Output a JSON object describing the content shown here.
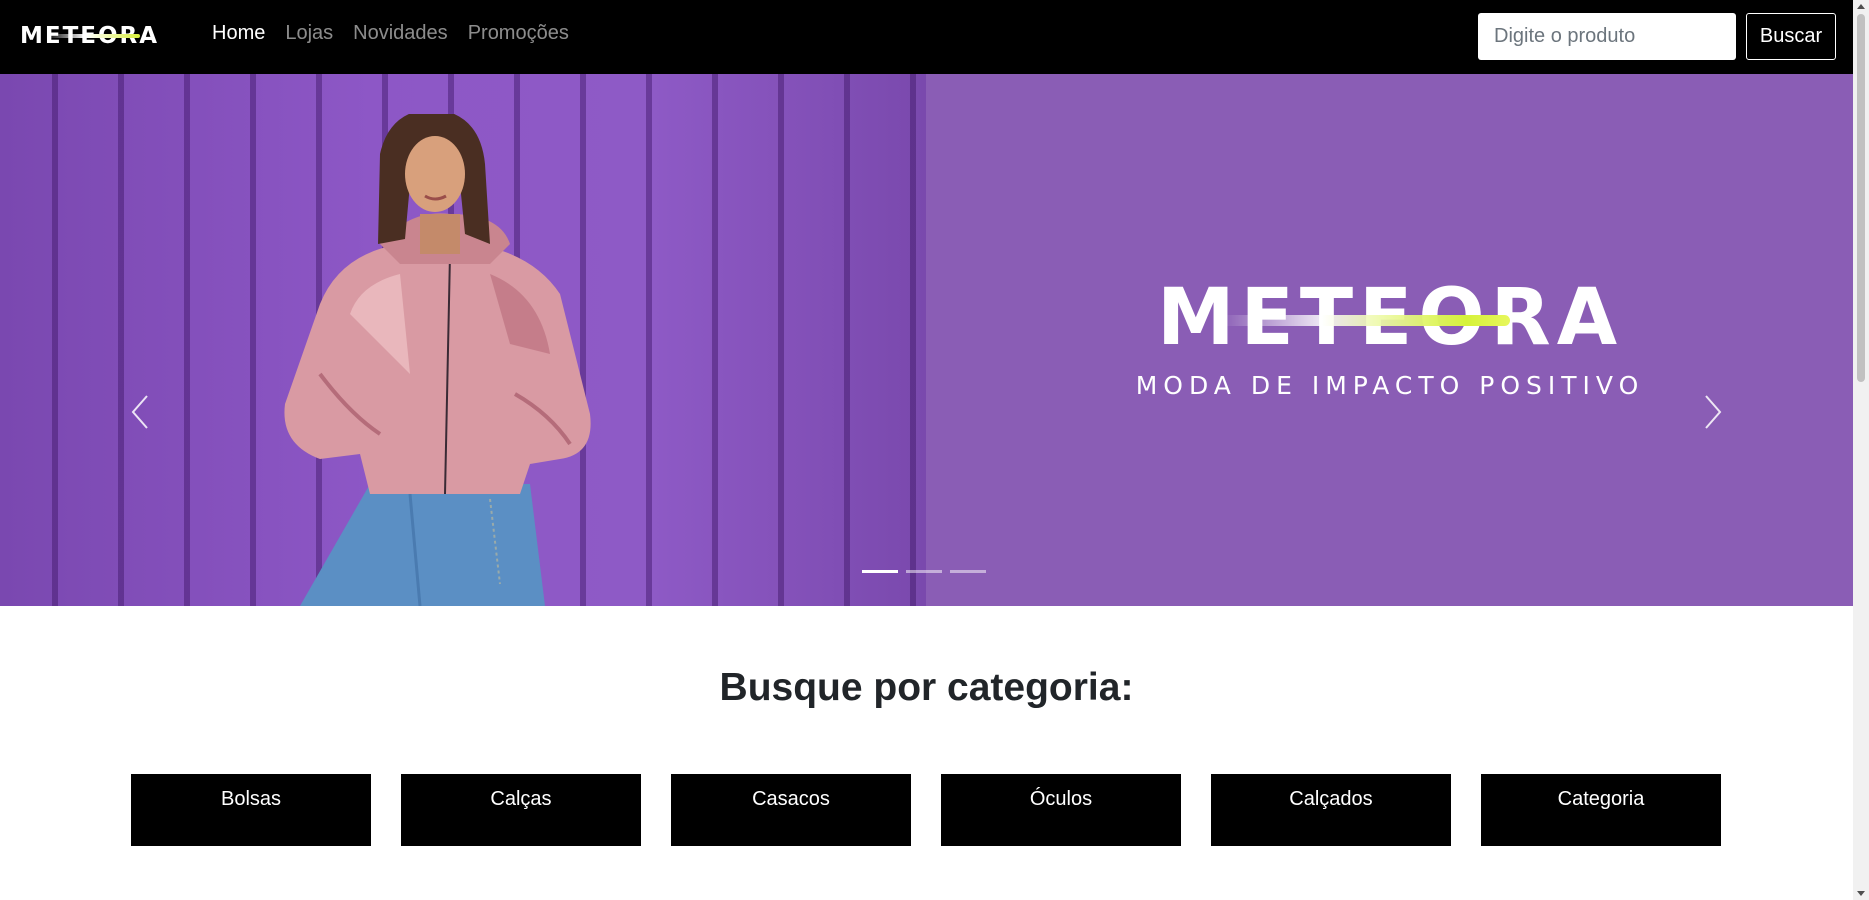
{
  "navbar": {
    "brand": "METEORA",
    "links": [
      {
        "label": "Home",
        "active": true
      },
      {
        "label": "Lojas",
        "active": false
      },
      {
        "label": "Novidades",
        "active": false
      },
      {
        "label": "Promoções",
        "active": false
      }
    ],
    "search": {
      "placeholder": "Digite o produto",
      "value": ""
    },
    "search_button": "Buscar"
  },
  "carousel": {
    "logo_word": "METEORA",
    "tagline": "MODA DE IMPACTO POSITIVO",
    "slides_total": 3,
    "active_slide": 1,
    "background_color": "#8a5db5",
    "accent_color": "#d6f23a"
  },
  "categories": {
    "title": "Busque por categoria:",
    "items": [
      "Bolsas",
      "Calças",
      "Casacos",
      "Óculos",
      "Calçados",
      "Categoria"
    ]
  }
}
